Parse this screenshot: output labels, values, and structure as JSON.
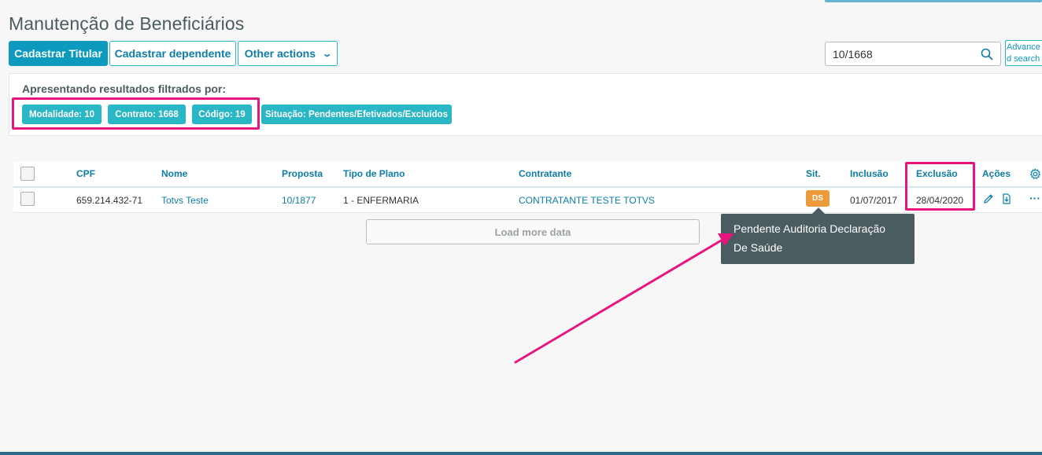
{
  "page": {
    "title": "Manutenção de Beneficiários"
  },
  "toolbar": {
    "primary_label": "Cadastrar Titular",
    "dependent_label": "Cadastrar dependente",
    "other_actions_label": "Other actions",
    "search_value": "10/1668",
    "advanced_search_label": "Advanced search"
  },
  "filters": {
    "label": "Apresentando resultados filtrados por:",
    "tags": [
      "Modalidade: 10",
      "Contrato: 1668",
      "Código: 19",
      "Situação: Pendentes/Efetivados/Excluídos"
    ]
  },
  "table": {
    "columns": {
      "cpf": "CPF",
      "nome": "Nome",
      "proposta": "Proposta",
      "tipo_plano": "Tipo de Plano",
      "contratante": "Contratante",
      "sit": "Sit.",
      "inclusao": "Inclusão",
      "exclusao": "Exclusão",
      "acoes": "Ações"
    },
    "rows": [
      {
        "cpf": "659.214.432-71",
        "nome": "Totvs Teste",
        "proposta": "10/1877",
        "tipo_plano": "1 - ENFERMARIA",
        "contratante": "CONTRATANTE TESTE TOTVS",
        "sit": "DS",
        "inclusao": "01/07/2017",
        "exclusao": "28/04/2020"
      }
    ],
    "load_more_label": "Load more data"
  },
  "tooltip": {
    "text": "Pendente Auditoria Declaração De Saúde"
  },
  "colors": {
    "primary": "#0c9abe",
    "tag": "#29b6c5",
    "badge_ds": "#ec9a3a",
    "highlight": "#e9157f",
    "tooltip_bg": "#4a5c60"
  },
  "icons": {
    "search": "search-icon",
    "edit": "pencil-icon",
    "download": "document-download-icon",
    "more": "more-options-icon",
    "settings": "gear-icon",
    "dropdown": "chevron-down-icon"
  }
}
